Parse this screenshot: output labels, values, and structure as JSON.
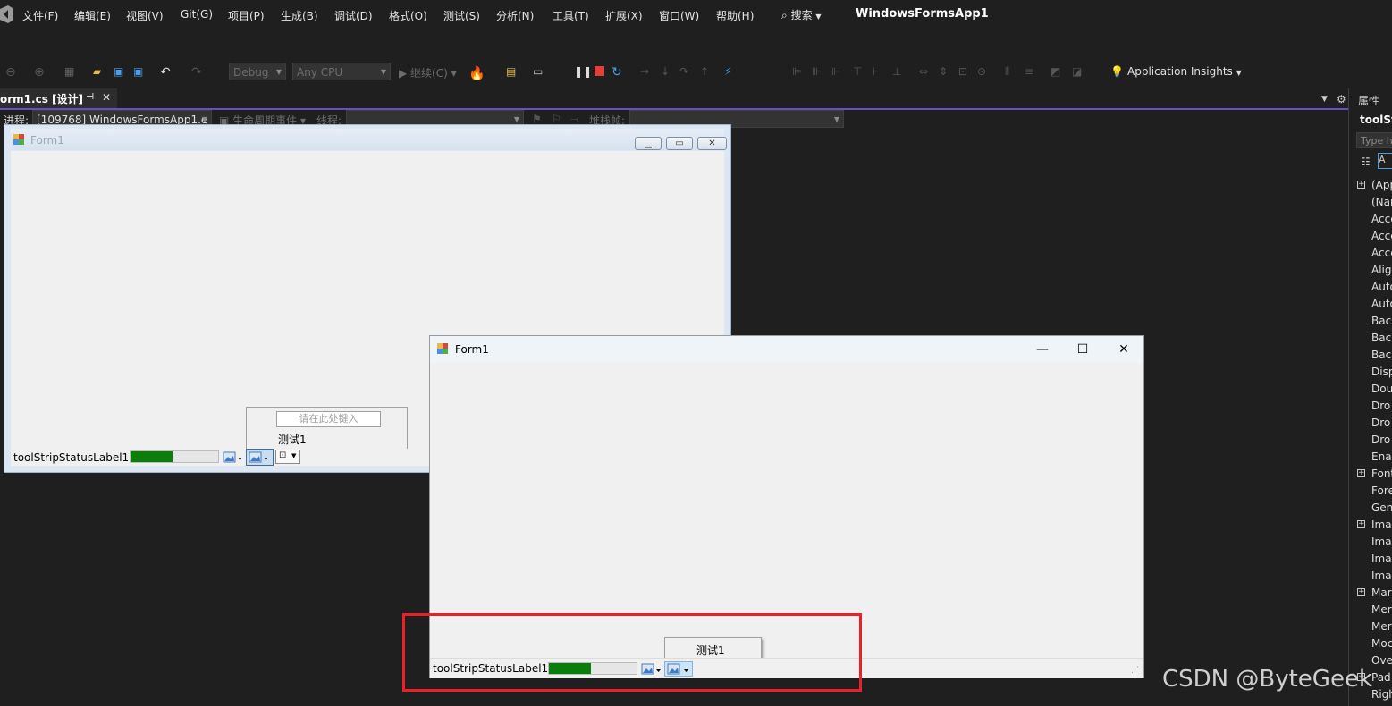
{
  "menubar": {
    "items": [
      "文件(F)",
      "编辑(E)",
      "视图(V)",
      "Git(G)",
      "项目(P)",
      "生成(B)",
      "调试(D)",
      "格式(O)",
      "测试(S)",
      "分析(N)",
      "工具(T)",
      "扩展(X)",
      "窗口(W)",
      "帮助(H)"
    ],
    "search": "搜索",
    "solution_title": "WindowsFormsApp1"
  },
  "toolbar": {
    "config": "Debug",
    "platform": "Any CPU",
    "continue": "继续(C)",
    "app_insights": "Application Insights"
  },
  "toolbar2": {
    "process_label": "进程:",
    "process_value": "[109768] WindowsFormsApp1.e",
    "lifecycle": "生命周期事件",
    "thread_label": "线程:",
    "stack_label": "堆栈帧:"
  },
  "doc_tab": {
    "label": "orm1.cs [设计]",
    "pin": "⊣",
    "close": "✕"
  },
  "designer": {
    "title": "Form1",
    "status_label": "toolStripStatusLabel1",
    "progress": 0.48,
    "type_here": "请在此处键入",
    "menu_item": "测试1"
  },
  "runtime": {
    "title": "Form1",
    "status_label": "toolStripStatusLabel1",
    "progress": 0.48,
    "menu_item": "测试1"
  },
  "properties": {
    "header": "属性",
    "object": "toolSt",
    "search_placeholder": "Type h",
    "rows": [
      "(App",
      "(Nar",
      "Acce",
      "Acce",
      "Acce",
      "Aligi",
      "Auto",
      "Auto",
      "Back",
      "Back",
      "Back",
      "Disp",
      "Dou",
      "Dro",
      "Dro",
      "Dro",
      "Enal",
      "Font",
      "Fore",
      "Gen",
      "Ima",
      "Ima",
      "Ima",
      "Ima",
      "Mar",
      "Mer",
      "Mer",
      "Moc",
      "Ove",
      "Pad",
      "Righ"
    ],
    "expandable": [
      0,
      17,
      20,
      24,
      29
    ]
  },
  "watermark": "CSDN @ByteGeek"
}
